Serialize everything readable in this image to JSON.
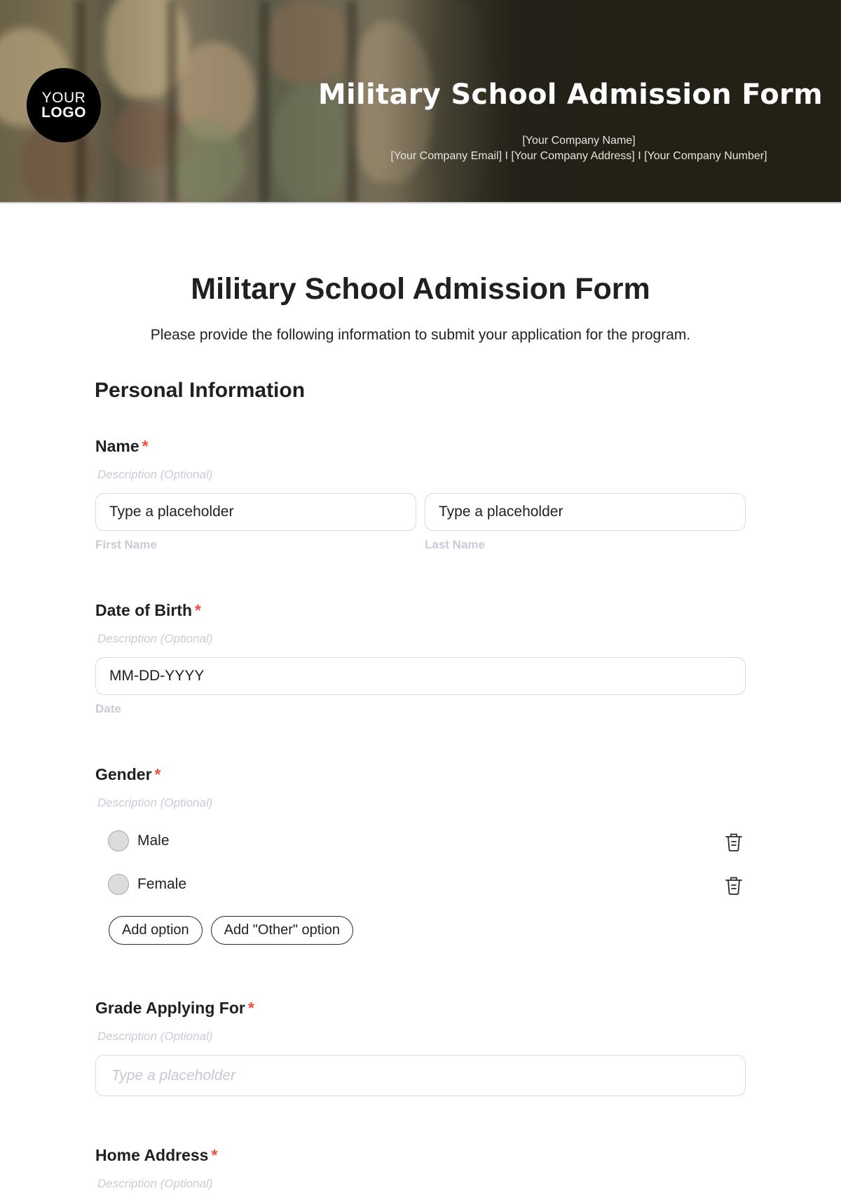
{
  "header": {
    "logo_line1": "YOUR",
    "logo_line2": "LOGO",
    "title": "Military School Admission Form",
    "company_name": "[Your Company Name]",
    "company_contact": "[Your Company Email] I [Your Company Address] I [Your Company Number]"
  },
  "form": {
    "title": "Military School Admission Form",
    "subtitle": "Please provide the following information to submit your application for the program.",
    "section_title": "Personal Information",
    "required_mark": "*",
    "questions": [
      {
        "label": "Name",
        "description": "Description (Optional)",
        "inputs": [
          {
            "value": "Type a placeholder",
            "sub_label": "First Name"
          },
          {
            "value": "Type a placeholder",
            "sub_label": "Last Name"
          }
        ]
      },
      {
        "label": "Date of Birth",
        "description": "Description (Optional)",
        "input": {
          "value": "MM-DD-YYYY",
          "sub_label": "Date"
        }
      },
      {
        "label": "Gender",
        "description": "Description (Optional)",
        "options": [
          {
            "label": "Male",
            "icon": "trash-icon"
          },
          {
            "label": "Female",
            "icon": "trash-icon"
          }
        ],
        "add_option_label": "Add option",
        "add_other_label": "Add \"Other\" option"
      },
      {
        "label": "Grade Applying For",
        "description": "Description (Optional)",
        "input": {
          "placeholder": "Type a placeholder"
        }
      },
      {
        "label": "Home Address",
        "description": "Description (Optional)"
      }
    ]
  },
  "colors": {
    "required": "#f04e3e",
    "banner_dark": "#232016",
    "muted_text": "#c8ccd6"
  }
}
